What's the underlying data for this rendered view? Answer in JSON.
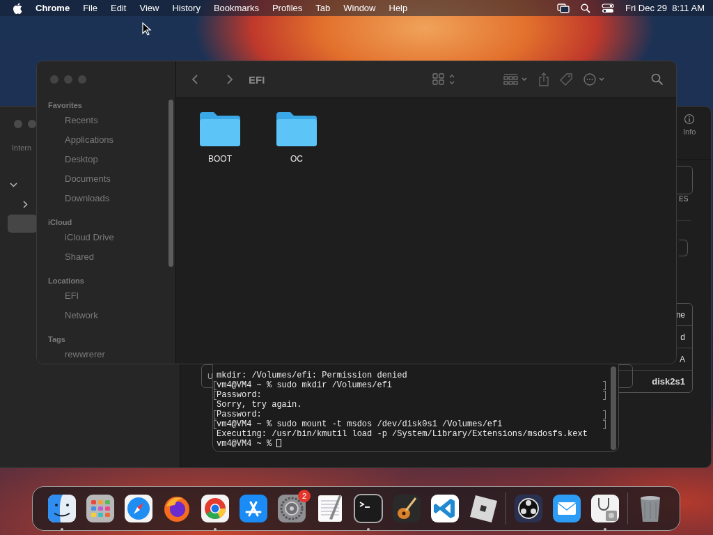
{
  "menu_bar": {
    "app_name": "Chrome",
    "menus": [
      "File",
      "Edit",
      "View",
      "History",
      "Bookmarks",
      "Profiles",
      "Tab",
      "Window",
      "Help"
    ],
    "clock": "Fri Dec 29  8:11 AM"
  },
  "background_window": {
    "sidebar_heading": "Intern",
    "info_button": "Info",
    "caption": "ES",
    "row_label": "U",
    "table_cells": [
      "ne",
      "d",
      "A",
      "disk2s1"
    ]
  },
  "terminal": {
    "lines": [
      {
        "text": "mkdir: /Volumes/efi: Permission denied",
        "marked": false
      },
      {
        "text": "vm4@VM4 ~ % sudo mkdir /Volumes/efi",
        "marked": true
      },
      {
        "text": "Password:",
        "marked": true
      },
      {
        "text": "Sorry, try again.",
        "marked": false
      },
      {
        "text": "Password:",
        "marked": true
      },
      {
        "text": "vm4@VM4 ~ % sudo mount -t msdos /dev/disk0s1 /Volumes/efi",
        "marked": true
      },
      {
        "text": "Executing: /usr/bin/kmutil load -p /System/Library/Extensions/msdosfs.kext",
        "marked": false
      },
      {
        "text": "vm4@VM4 ~ %",
        "marked": false,
        "cursor": true
      }
    ]
  },
  "finder": {
    "title": "EFI",
    "sidebar": [
      {
        "title": "Favorites",
        "items": [
          "Recents",
          "Applications",
          "Desktop",
          "Documents",
          "Downloads"
        ]
      },
      {
        "title": "iCloud",
        "items": [
          "iCloud Drive",
          "Shared"
        ]
      },
      {
        "title": "Locations",
        "items": [
          "EFI",
          "Network"
        ]
      },
      {
        "title": "Tags",
        "items": [
          "rewwrerer"
        ]
      }
    ],
    "files": [
      {
        "name": "BOOT",
        "kind": "folder"
      },
      {
        "name": "OC",
        "kind": "folder"
      }
    ]
  },
  "dock": {
    "apps": [
      {
        "kind": "finder",
        "running": true
      },
      {
        "kind": "launchpad",
        "running": false
      },
      {
        "kind": "safari",
        "running": false
      },
      {
        "kind": "firefox",
        "running": false
      },
      {
        "kind": "chrome",
        "running": true
      },
      {
        "kind": "appstore",
        "running": false
      },
      {
        "kind": "settings",
        "running": false,
        "badge": "2"
      },
      {
        "kind": "textedit",
        "running": false
      },
      {
        "kind": "terminal",
        "running": true
      },
      {
        "kind": "garageband",
        "running": false
      },
      {
        "kind": "vscode",
        "running": false
      },
      {
        "kind": "roblox",
        "running": false
      }
    ],
    "recent": [
      {
        "kind": "obs",
        "running": false
      },
      {
        "kind": "mail",
        "running": false
      },
      {
        "kind": "diskutility",
        "running": true
      }
    ],
    "trash": {
      "kind": "trash",
      "running": false
    }
  }
}
